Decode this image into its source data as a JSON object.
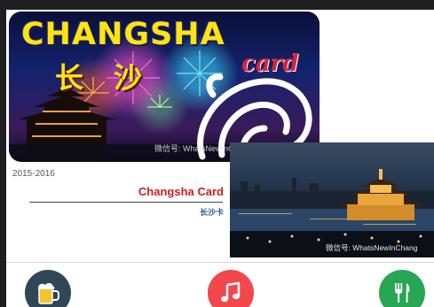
{
  "card": {
    "title": "CHANGSHA",
    "word": "card",
    "cn_char_1": "长",
    "cn_char_2": "沙",
    "watermark": "微信号: WhatsNewInChangsha"
  },
  "info": {
    "season": "2015-2016",
    "card_name": "Changsha Card",
    "card_name_cn": "长沙卡"
  },
  "photo": {
    "watermark": "微信号: WhatsNewInChang"
  },
  "bottom_icons": [
    {
      "name": "beer-icon",
      "color": "#2f4757"
    },
    {
      "name": "music-icon",
      "color": "#f2474b"
    },
    {
      "name": "fork-knife-icon",
      "color": "#27a653"
    }
  ]
}
